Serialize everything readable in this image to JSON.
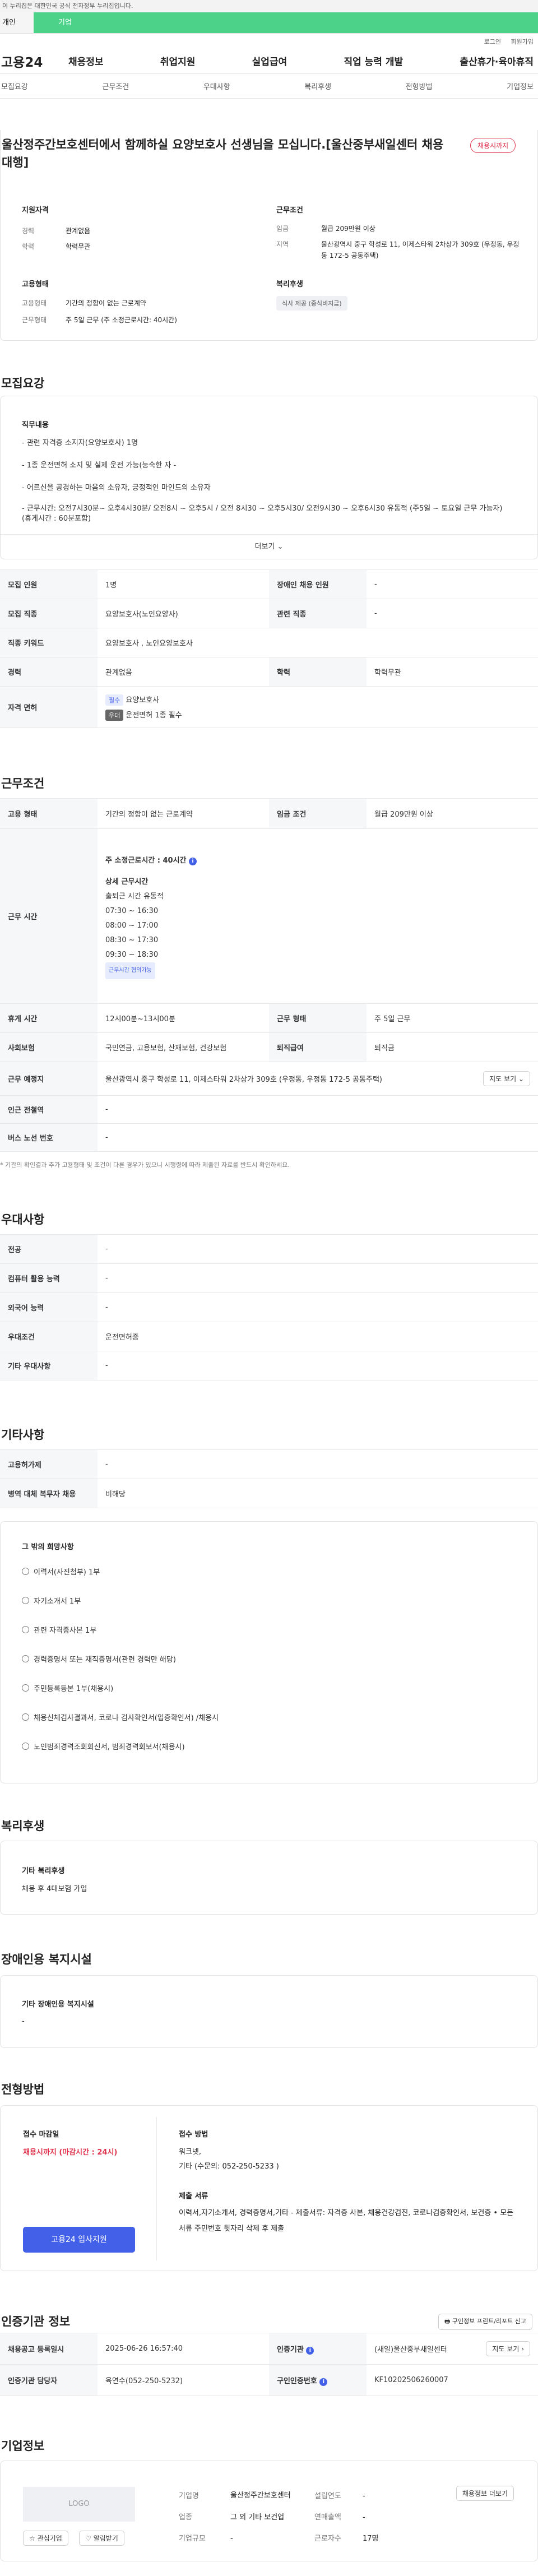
{
  "gov_banner": "이 누리집은 대한민국 공식 전자정부 누리집입니다.",
  "tabs": [
    "개인",
    "기업"
  ],
  "util_links": [
    "로그인",
    "회원가입"
  ],
  "logo": "고용24",
  "gnb": [
    "채용정보",
    "취업지원",
    "실업급여",
    "직업 능력 개발",
    "출산휴가·육아휴직"
  ],
  "subnav": [
    "모집요강",
    "근무조건",
    "우대사항",
    "복리후생",
    "전형방법",
    "기업정보"
  ],
  "job": {
    "title": "울산정주간보호센터에서 함께하실 요양보호사 선생님을 모십니다.[울산중부새일센터 채용대행]",
    "status_badge": "채용시까지",
    "support_title": "지원자격",
    "support": [
      {
        "k": "경력",
        "v": "관계없음"
      },
      {
        "k": "학력",
        "v": "학력무관"
      }
    ],
    "work_title": "근무조건",
    "work": [
      {
        "k": "임금",
        "v": "월급 209만원 이상"
      },
      {
        "k": "지역",
        "v": "울산광역시 중구 학성로 11, 이제스타워 2차상가 309호 (우정동, 우정동 172-5 공동주택)"
      }
    ],
    "emp_title": "고용형태",
    "emp": [
      {
        "k": "고용형태",
        "v": "기간의 정함이 없는 근로계약"
      },
      {
        "k": "근무형태",
        "v": "주 5일 근무 (주 소정근로시간: 40시간)"
      }
    ],
    "welfare_title": "복리후생",
    "welfare_chip": "식사 제공 (중식비지급)"
  },
  "recruit": {
    "section_title": "모집요강",
    "duty_title": "직무내용",
    "duty_lines": [
      "- 관련 자격증 소지자(요양보호사) 1명",
      "- 1종 운전면허 소지 및 실제 운전 가능(능숙한 자 -",
      "- 어르신을 공경하는 마음의 소유자, 긍정적인 마인드의 소유자",
      "- 근무시간: 오전7시30분~ 오후4시30분/ 오전8시 ~ 오후5시 / 오전 8시30 ~ 오후5시30/ 오전9시30 ~ 오후6시30  유동적 (주5일 ~ 토요일 근무 가능자)",
      "(휴게시간 : 60분포함)"
    ],
    "more_label": "더보기",
    "table": [
      {
        "k": "모집 인원",
        "v": "1명",
        "k2": "장애인 채용 인원",
        "v2": "-"
      },
      {
        "k": "모집 직종",
        "v": "요양보호사(노인요양사)",
        "k2": "관련 직종",
        "v2": "-"
      },
      {
        "k": "직종 키워드",
        "v": "요양보호사 , 노인요양보호사",
        "k2": "",
        "": ""
      },
      {
        "k": "경력",
        "v": "관계없음",
        "k2": "학력",
        "v2": "학력무관"
      }
    ],
    "license_label": "자격 면허",
    "licenses": [
      {
        "tag": "필수",
        "name": "요양보호사"
      },
      {
        "tag": "우대",
        "name": "운전면허 1종 필수"
      }
    ]
  },
  "conditions": {
    "section_title": "근무조건",
    "emp_label": "고용 형태",
    "emp_value": "기간의 정함이 없는 근로계약",
    "wage_label": "임금 조건",
    "wage_value": "월급 209만원 이상",
    "hours_label": "근무 시간",
    "weekly": "주 소정근로시간 : 40시간",
    "detail_title": "상세 근무시간",
    "detail_sub": "출퇴근 시간 유동적",
    "times": [
      "07:30 ~ 16:30",
      "08:00 ~ 17:00",
      "08:30 ~ 17:30",
      "09:30 ~ 18:30"
    ],
    "flex_chip": "근무시간 협의가능",
    "rows": [
      {
        "k": "휴게 시간",
        "v": "12시00분~13시00분",
        "k2": "근무 형태",
        "v2": "주 5일 근무"
      },
      {
        "k": "사회보험",
        "v": "국민연금, 고용보험, 산재보험, 건강보험",
        "k2": "퇴직급여",
        "v2": "퇴직금"
      }
    ],
    "place_label": "근무 예정지",
    "place_value": "울산광역시 중구 학성로 11, 이제스타워 2차상가 309호 (우정동, 우정동 172-5 공동주택)",
    "map_btn": "지도 보기",
    "station_label": "인근 전철역",
    "station_value": "-",
    "bus_label": "버스 노선 번호",
    "bus_value": "-",
    "note": "* 기관의 확인결과 추가 고용형태 및 조건이 다른 경우가 있으니 시행령에 따라 제출된 자료를 반드시 확인하세요."
  },
  "preference": {
    "section_title": "우대사항",
    "rows": [
      {
        "k": "전공",
        "v": "-"
      },
      {
        "k": "컴퓨터 활용 능력",
        "v": "-"
      },
      {
        "k": "외국어 능력",
        "v": "-"
      },
      {
        "k": "우대조건",
        "v": "운전면허증"
      },
      {
        "k": "기타 우대사항",
        "v": "-"
      }
    ]
  },
  "others": {
    "section_title": "기타사항",
    "rows": [
      {
        "k": "고용허가제",
        "v": "-"
      },
      {
        "k": "병역 대체 복무자 채용",
        "v": "비해당"
      }
    ],
    "docs_title": "그 밖의 희망사항",
    "docs": [
      "이력서(사진첨부) 1부",
      "자기소개서 1부",
      "관련 자격증사본 1부",
      "경력증명서 또는 재직증명서(관련 경력만 해당)",
      "주민등록등본 1부(채용시)",
      "채용신체검사결과서, 코로나 검사확인서(입증확인서) /채용시",
      "노인범죄경력조회회신서, 범죄경력회보서(채용시)"
    ]
  },
  "benefits": {
    "section_title": "복리후생",
    "box_title": "기타 복리후생",
    "box_value": "채용 후 4대보험 가입"
  },
  "disability": {
    "section_title": "장애인용 복지시설",
    "box_title": "기타 장애인용 복지시설",
    "box_value": "-"
  },
  "selection": {
    "section_title": "전형방법",
    "deadline_title": "접수 마감일",
    "deadline_value": "채용시까지 (마감시간 : 24시)",
    "apply_btn": "고용24 입사지원",
    "method_title": "접수 방법",
    "method_lines": [
      "워크넷,",
      "기타 (수문의: 052-250-5233 )"
    ],
    "docs_title": "제출 서류",
    "docs_text": "이력서,자기소개서, 경력증명서,기타 - 제출서류: 자격증 사본, 채용건강검진, 코로나검증확인서, 보건증  • 모든 서류 주민번호 뒷자리 삭제 후 제출"
  },
  "agency": {
    "section_title": "인증기관 정보",
    "print_btn": "구인정보 프린트/리포트 신고",
    "rows": [
      {
        "k": "채용공고 등록일시",
        "v": "2025-06-26 16:57:40",
        "k2": "인증기관",
        "v2": "(새일)울산중부새일센터",
        "btn": "지도 보기"
      },
      {
        "k": "인증기관 담당자",
        "v": "육연수(052-250-5232)",
        "k2": "구인인증번호",
        "v2": "KF10202506260007"
      }
    ]
  },
  "company": {
    "section_title": "기업정보",
    "logo_text": "LOGO",
    "interest_btn": "관심기업",
    "hire_btn": "알림받기",
    "cols": [
      {
        "k": "기업명",
        "v": "울산정주간보호센터"
      },
      {
        "k": "업종",
        "v": "그 외 기타 보건업"
      },
      {
        "k": "기업규모",
        "v": "-"
      }
    ],
    "cols2": [
      {
        "k": "설립연도",
        "v": "-"
      },
      {
        "k": "연매출액",
        "v": "-"
      },
      {
        "k": "근로자수",
        "v": "17명"
      }
    ],
    "more_btn": "채용정보 더보기"
  },
  "colors": {
    "primary": "#4360e8",
    "green": "#4dd28a",
    "red": "#e0304b"
  }
}
